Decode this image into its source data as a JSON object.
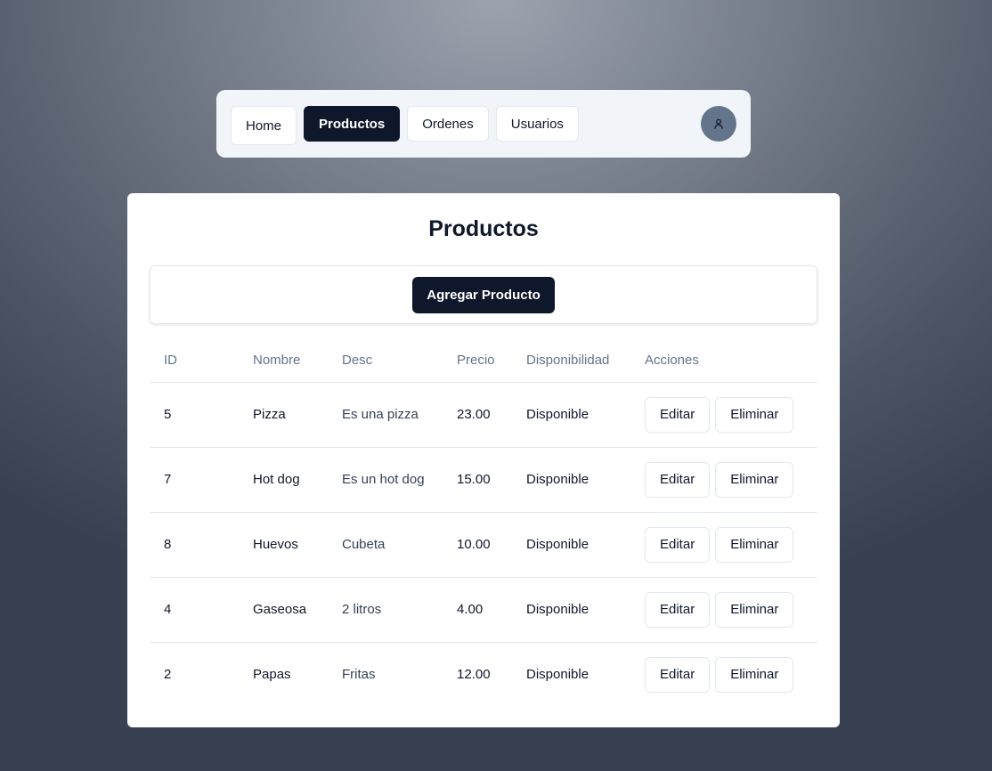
{
  "nav": {
    "items": [
      {
        "label": "Home",
        "active": false
      },
      {
        "label": "Productos",
        "active": true
      },
      {
        "label": "Ordenes",
        "active": false
      },
      {
        "label": "Usuarios",
        "active": false
      }
    ],
    "avatar_icon": "user-icon"
  },
  "page": {
    "title": "Productos",
    "add_button": "Agregar Producto"
  },
  "table": {
    "headers": [
      "ID",
      "Nombre",
      "Desc",
      "Precio",
      "Disponibilidad",
      "Acciones"
    ],
    "rows": [
      {
        "id": "5",
        "name": "Pizza",
        "desc": "Es una pizza",
        "price": "23.00",
        "status": "Disponible",
        "edit": "Editar",
        "delete": "Eliminar"
      },
      {
        "id": "7",
        "name": "Hot dog",
        "desc": "Es un hot dog",
        "price": "15.00",
        "status": "Disponible",
        "edit": "Editar",
        "delete": "Eliminar"
      },
      {
        "id": "8",
        "name": "Huevos",
        "desc": "Cubeta",
        "price": "10.00",
        "status": "Disponible",
        "edit": "Editar",
        "delete": "Eliminar"
      },
      {
        "id": "4",
        "name": "Gaseosa",
        "desc": "2 litros",
        "price": "4.00",
        "status": "Disponible",
        "edit": "Editar",
        "delete": "Eliminar"
      },
      {
        "id": "2",
        "name": "Papas",
        "desc": "Fritas",
        "price": "12.00",
        "status": "Disponible",
        "edit": "Editar",
        "delete": "Eliminar"
      }
    ]
  },
  "colors": {
    "primary": "#0f172a",
    "muted_text": "#64748b",
    "border": "#e2e8f0",
    "nav_bg": "#f1f5f9",
    "avatar_bg": "#64748b"
  }
}
